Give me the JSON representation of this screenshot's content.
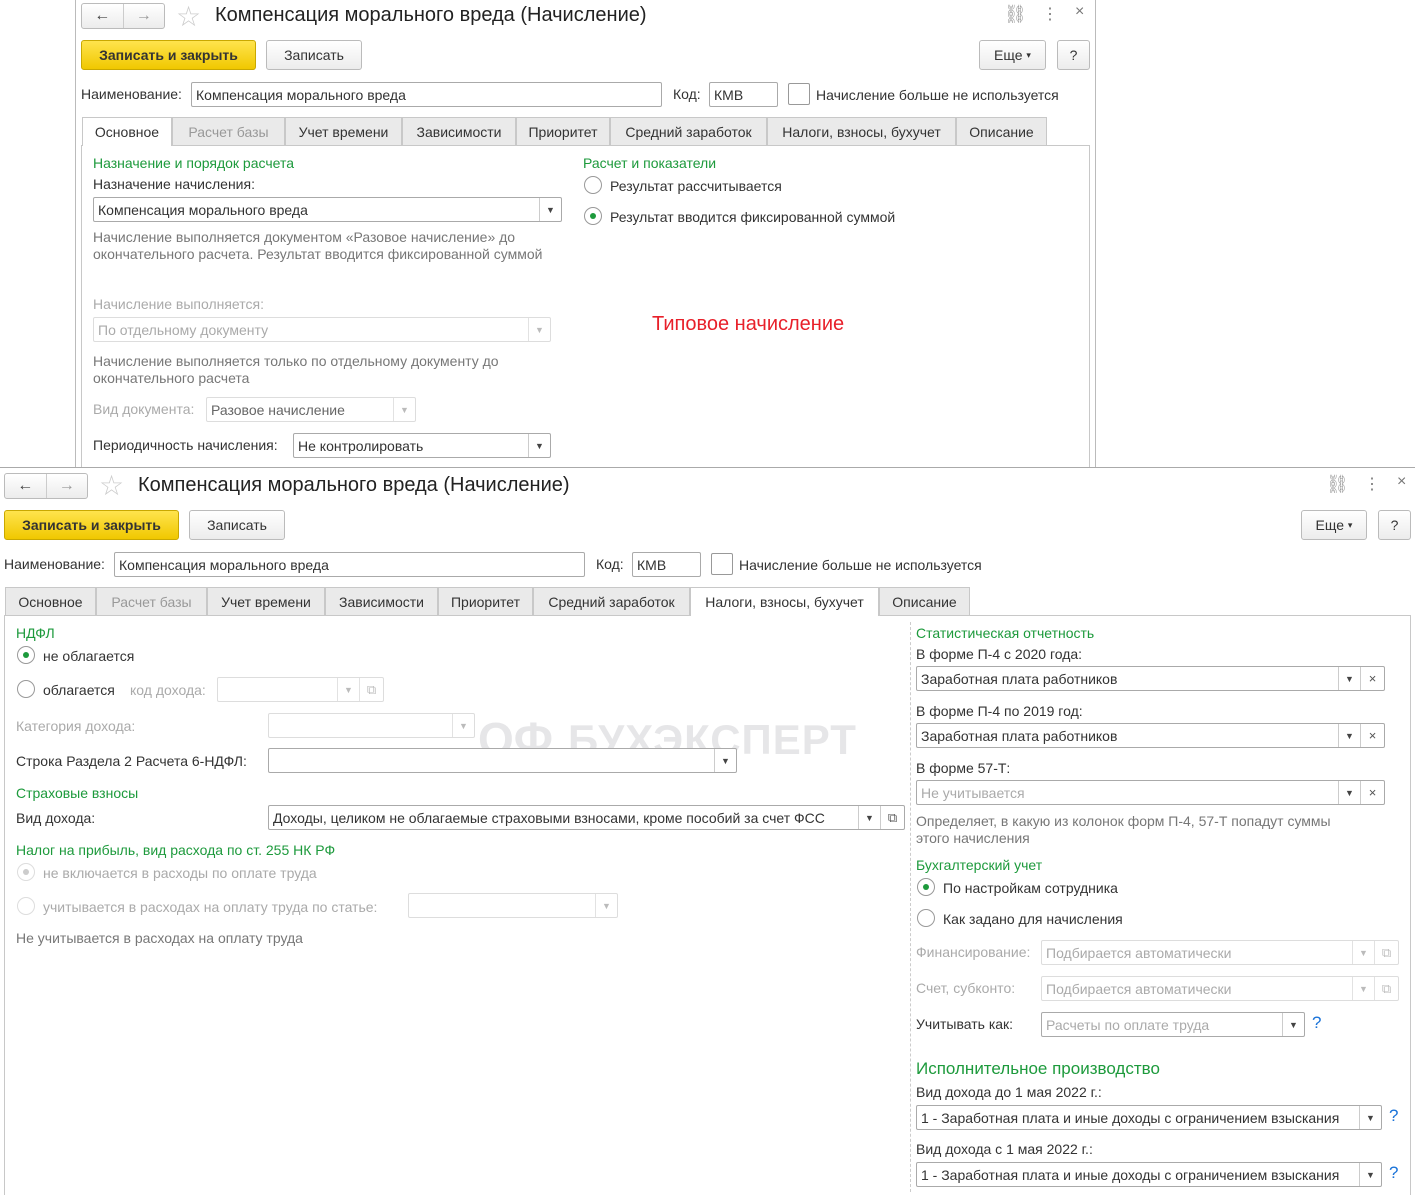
{
  "common": {
    "title": "Компенсация морального вреда (Начисление)",
    "save_close": "Записать и закрыть",
    "save": "Записать",
    "more": "Еще",
    "help": "?",
    "name_label": "Наименование:",
    "name_value": "Компенсация морального вреда",
    "code_label": "Код:",
    "code_value": "КМВ",
    "unused_label": "Начисление больше не используется",
    "tabs": [
      "Основное",
      "Расчет базы",
      "Учет времени",
      "Зависимости",
      "Приоритет",
      "Средний заработок",
      "Налоги, взносы, бухучет",
      "Описание"
    ],
    "icons": {
      "back": "←",
      "forward": "→",
      "star": "☆",
      "link": "🔗",
      "menu": "⋮",
      "close": "×",
      "dropdown": "▾",
      "clear": "×",
      "open": "⧉"
    }
  },
  "top": {
    "section_left": "Назначение и порядок расчета",
    "purpose_label": "Назначение начисления:",
    "purpose_value": "Компенсация морального вреда",
    "purpose_desc": "Начисление выполняется документом «Разовое начисление» до окончательного расчета. Результат вводится фиксированной суммой",
    "exec_label": "Начисление выполняется:",
    "exec_value": "По отдельному документу",
    "exec_desc": "Начисление выполняется только по отдельному документу до окончательного расчета",
    "doc_label": "Вид документа:",
    "doc_value": "Разовое начисление",
    "period_label": "Периодичность начисления:",
    "period_value": "Не контролировать",
    "section_right": "Расчет и показатели",
    "radio_calc": "Результат рассчитывается",
    "radio_fixed": "Результат вводится фиксированной суммой",
    "annotation": "Типовое начисление"
  },
  "bottom": {
    "ndfl": "НДФЛ",
    "not_taxed": "не облагается",
    "taxed": "облагается",
    "income_code_label": "код дохода:",
    "income_cat_label": "Категория дохода:",
    "row6_label": "Строка Раздела 2 Расчета 6-НДФЛ:",
    "insurance": "Страховые взносы",
    "income_kind_label": "Вид дохода:",
    "income_kind_value": "Доходы, целиком не облагаемые страховыми взносами, кроме пособий за счет ФСС",
    "profit_tax": "Налог на прибыль, вид расхода по ст. 255 НК РФ",
    "not_included": "не включается в расходы по оплате труда",
    "included": "учитывается в расходах на оплату труда по статье:",
    "profit_note": "Не учитывается в расходах на оплату труда",
    "watermark": "БУХЭКСПЕРТ",
    "stat": "Статистическая отчетность",
    "p4_2020_label": "В форме П-4 с 2020 года:",
    "p4_2020_value": "Заработная плата работников",
    "p4_2019_label": "В форме П-4 по 2019 год:",
    "p4_2019_value": "Заработная плата работников",
    "f57_label": "В форме 57-Т:",
    "f57_placeholder": "Не учитывается",
    "stat_desc": "Определяет, в какую из колонок форм П-4, 57-Т попадут суммы этого начисления",
    "accounting": "Бухгалтерский учет",
    "by_employee": "По настройкам сотрудника",
    "as_set": "Как задано для начисления",
    "financing_label": "Финансирование:",
    "financing_value": "Подбирается автоматически",
    "account_label": "Счет, субконто:",
    "account_value": "Подбирается автоматически",
    "account_as_label": "Учитывать как:",
    "account_as_value": "Расчеты по оплате труда",
    "enforcement": "Исполнительное производство",
    "before_label": "Вид дохода до 1 мая 2022 г.:",
    "before_value": "1 - Заработная плата и иные доходы с ограничением взыскания",
    "after_label": "Вид дохода с 1 мая 2022 г.:",
    "after_value": "1 - Заработная плата и иные доходы с ограничением взыскания"
  }
}
